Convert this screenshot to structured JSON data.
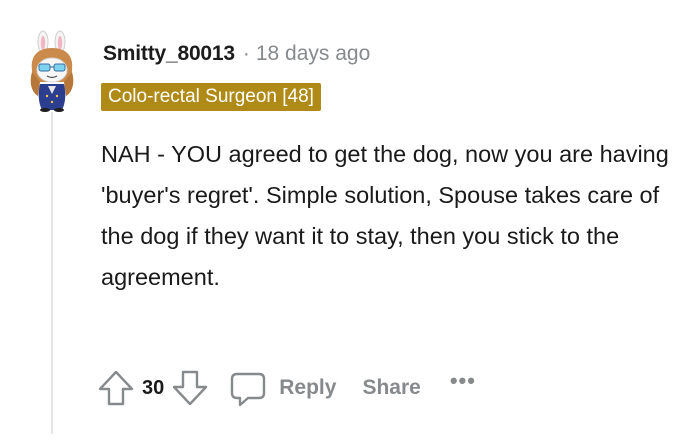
{
  "comment": {
    "author": "Smitty_80013",
    "separator": "·",
    "timestamp": "18 days ago",
    "flair": "Colo-rectal Surgeon [48]",
    "body": "NAH - YOU agreed to get the dog, now you are having 'buyer's regret'. Simple solution, Spouse takes care of the dog if they want it to stay, then you stick to the agreement.",
    "vote_count": "30",
    "reply_label": "Reply",
    "share_label": "Share",
    "more_label": "•••"
  },
  "icons": {
    "upvote": "arrow-up-icon",
    "downvote": "arrow-down-icon",
    "reply": "speech-bubble-icon",
    "more": "ellipsis-icon"
  },
  "colors": {
    "flair_bg": "#b08a17",
    "muted": "#878a8c",
    "text": "#1a1a1b"
  }
}
